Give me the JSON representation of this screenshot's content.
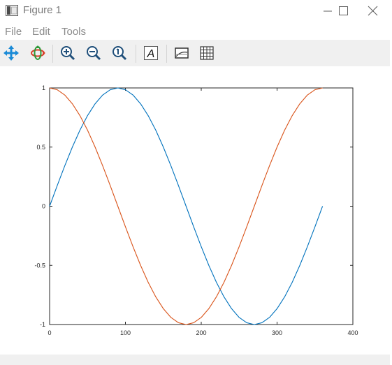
{
  "window": {
    "title": "Figure 1"
  },
  "menu": {
    "items": [
      {
        "label": "File"
      },
      {
        "label": "Edit"
      },
      {
        "label": "Tools"
      }
    ]
  },
  "toolbar": {
    "buttons": [
      {
        "icon": "pan-icon"
      },
      {
        "icon": "rotate-icon"
      },
      {
        "icon": "zoom-in-icon"
      },
      {
        "icon": "zoom-out-icon"
      },
      {
        "icon": "zoom-reset-icon"
      },
      {
        "icon": "text-annotation-icon"
      },
      {
        "icon": "axes-toggle-icon"
      },
      {
        "icon": "grid-toggle-icon"
      }
    ]
  },
  "chart_data": {
    "type": "line",
    "x": [
      0,
      10,
      20,
      30,
      40,
      50,
      60,
      70,
      80,
      90,
      100,
      110,
      120,
      130,
      140,
      150,
      160,
      170,
      180,
      190,
      200,
      210,
      220,
      230,
      240,
      250,
      260,
      270,
      280,
      290,
      300,
      310,
      320,
      330,
      340,
      350,
      360
    ],
    "series": [
      {
        "values": [
          0,
          0.174,
          0.342,
          0.5,
          0.643,
          0.766,
          0.866,
          0.94,
          0.985,
          1,
          0.985,
          0.94,
          0.866,
          0.766,
          0.643,
          0.5,
          0.342,
          0.174,
          0,
          -0.174,
          -0.342,
          -0.5,
          -0.643,
          -0.766,
          -0.866,
          -0.94,
          -0.985,
          -1,
          -0.985,
          -0.94,
          -0.866,
          -0.766,
          -0.643,
          -0.5,
          -0.342,
          -0.174,
          0
        ],
        "color": "#0072bd"
      },
      {
        "values": [
          1,
          0.985,
          0.94,
          0.866,
          0.766,
          0.643,
          0.5,
          0.342,
          0.174,
          0,
          -0.174,
          -0.342,
          -0.5,
          -0.643,
          -0.766,
          -0.866,
          -0.94,
          -0.985,
          -1,
          -0.985,
          -0.94,
          -0.866,
          -0.766,
          -0.643,
          -0.5,
          -0.342,
          -0.174,
          0,
          0.174,
          0.342,
          0.5,
          0.643,
          0.766,
          0.866,
          0.94,
          0.985,
          1
        ],
        "color": "#d95319"
      }
    ],
    "xlim": [
      0,
      400
    ],
    "ylim": [
      -1,
      1
    ],
    "xticks": [
      {
        "value": 0,
        "label": "0"
      },
      {
        "value": 100,
        "label": "100"
      },
      {
        "value": 200,
        "label": "200"
      },
      {
        "value": 300,
        "label": "300"
      },
      {
        "value": 400,
        "label": "400"
      }
    ],
    "yticks": [
      {
        "value": 1,
        "label": "1"
      },
      {
        "value": 0.5,
        "label": "0.5"
      },
      {
        "value": 0,
        "label": "0"
      },
      {
        "value": -0.5,
        "label": "-0.5"
      },
      {
        "value": -1,
        "label": "-1"
      }
    ],
    "grid": false,
    "box": true
  }
}
